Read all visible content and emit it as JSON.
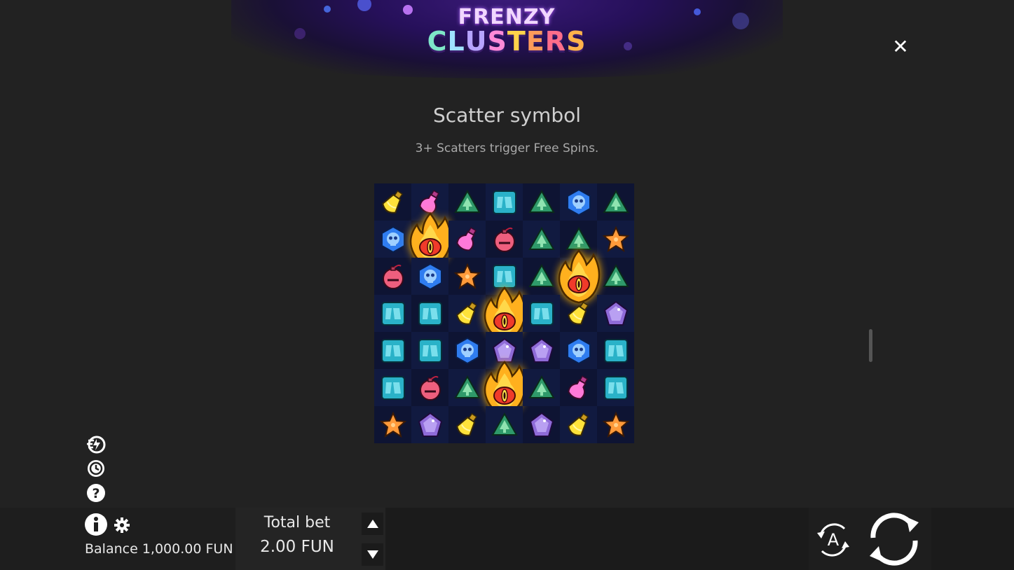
{
  "header": {
    "logo_line1": "FRENZY",
    "logo_line2": [
      "C",
      "L",
      "U",
      "S",
      "T",
      "E",
      "R",
      "S"
    ],
    "logo_colors": [
      "#7ee6c8",
      "#9fe3ff",
      "#b6a4ff",
      "#ff8ad8",
      "#ffd24a",
      "#ff9b5a",
      "#ff6d8a",
      "#ffb24a"
    ]
  },
  "close_label": "✕",
  "info": {
    "title": "Scatter symbol",
    "subtitle": "3+ Scatters trigger Free Spins."
  },
  "grid": {
    "rows": [
      [
        "potion-yellow",
        "potion-pink",
        "tree",
        "card",
        "tree",
        "skull",
        "tree"
      ],
      [
        "skull",
        "scatter",
        "potion-pink",
        "bomb",
        "tree",
        "tree",
        "star"
      ],
      [
        "bomb",
        "skull",
        "star",
        "card",
        "tree",
        "scatter",
        "tree"
      ],
      [
        "card",
        "card",
        "potion-yellow",
        "scatter",
        "card",
        "potion-yellow",
        "gem"
      ],
      [
        "card",
        "card",
        "skull",
        "gem",
        "gem",
        "skull",
        "card"
      ],
      [
        "card",
        "bomb",
        "tree",
        "scatter",
        "tree",
        "potion-pink",
        "card"
      ],
      [
        "star",
        "gem",
        "potion-yellow",
        "tree",
        "gem",
        "potion-yellow",
        "star"
      ]
    ]
  },
  "side_icons": [
    "speed-icon",
    "history-icon",
    "help-icon"
  ],
  "bottom": {
    "balance_label": "Balance",
    "balance_value": "1,000.00 FUN",
    "bet_label": "Total bet",
    "bet_value": "2.00 FUN",
    "autoplay_letter": "A"
  }
}
